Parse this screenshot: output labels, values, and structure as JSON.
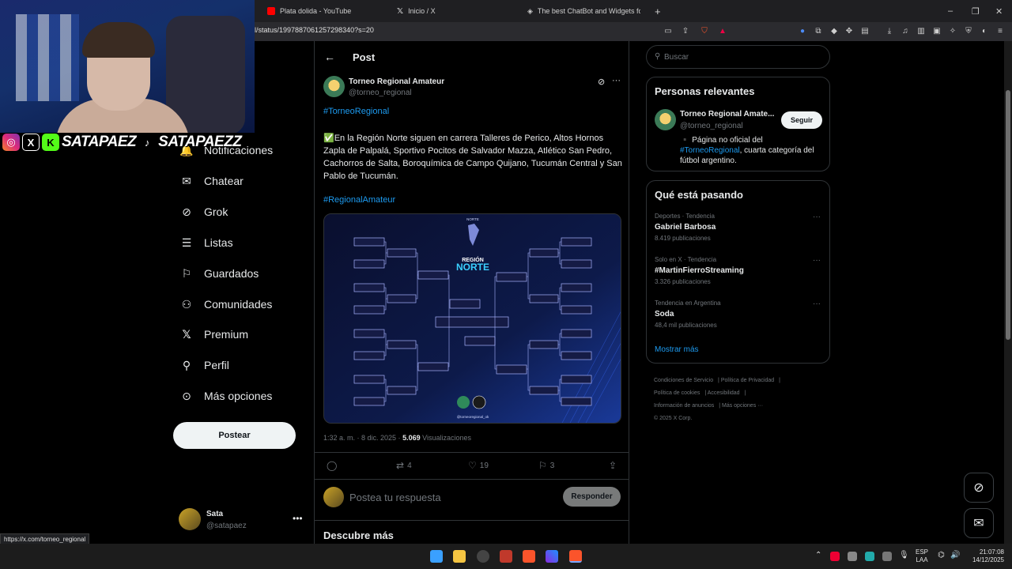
{
  "tabs": [
    {
      "title": "Plata dolida - YouTube",
      "icon": "youtube-icon",
      "color": "#ff0000"
    },
    {
      "title": "Inicio / X",
      "icon": "x-icon",
      "color": "#ffffff"
    },
    {
      "title": "The best ChatBot and Widgets for Ki",
      "icon": "chatbot-icon",
      "color": "#ffffff"
    }
  ],
  "url": "l/status/1997887061257298340?s=20",
  "nav": [
    {
      "label": "Notificaciones",
      "icon": "bell-icon"
    },
    {
      "label": "Chatear",
      "icon": "mail-icon"
    },
    {
      "label": "Grok",
      "icon": "grok-icon"
    },
    {
      "label": "Listas",
      "icon": "list-icon"
    },
    {
      "label": "Guardados",
      "icon": "bookmark-icon"
    },
    {
      "label": "Comunidades",
      "icon": "communities-icon"
    },
    {
      "label": "Premium",
      "icon": "x-icon"
    },
    {
      "label": "Perfil",
      "icon": "person-icon"
    },
    {
      "label": "Más opciones",
      "icon": "more-circle-icon"
    }
  ],
  "post_button": "Postear",
  "me": {
    "name": "Sata",
    "handle": "@satapaez"
  },
  "header": {
    "title": "Post"
  },
  "post": {
    "author": "Torneo Regional Amateur",
    "handle": "@torneo_regional",
    "hashtag1": "#TorneoRegional",
    "body": "✅En la Región Norte siguen en carrera Talleres de Perico, Altos Hornos Zapla de Palpalá, Sportivo Pocitos de Salvador Mazza, Atlético San Pedro, Cachorros de Salta, Boroquímica de Campo Quijano, Tucumán Central y San Pablo de Tucumán.",
    "hashtag2": "#RegionalAmateur",
    "image": {
      "banner": "NORTE",
      "title_small": "REGIÓN",
      "title_big": "NORTE",
      "credit": "@torneoregional_ok"
    },
    "time": "1:32 a. m. · 8 dic. 2025 · ",
    "views_count": "5.069",
    "views_label": "Visualizaciones",
    "replies": "",
    "reposts": "4",
    "likes": "19",
    "bookmarks": "3"
  },
  "reply": {
    "placeholder": "Postea tu respuesta",
    "button": "Responder"
  },
  "discover": "Descubre más",
  "search": {
    "placeholder": "Buscar"
  },
  "relevant": {
    "title": "Personas relevantes",
    "name": "Torneo Regional Amate...",
    "handle": "@torneo_regional",
    "follow": "Seguir",
    "bio_pre": "▪️ Página no oficial del ",
    "bio_tag": "#TorneoRegional",
    "bio_post": ", cuarta categoría del fútbol argentino."
  },
  "trends": {
    "title": "Qué está pasando",
    "items": [
      {
        "category": "Deportes · Tendencia",
        "title": "Gabriel Barbosa",
        "count": "8.419 publicaciones"
      },
      {
        "category": "Solo en X · Tendencia",
        "title": "#MartinFierroStreaming",
        "count": "3.326 publicaciones"
      },
      {
        "category": "Tendencia en Argentina",
        "title": "Soda",
        "count": "48,4 mil publicaciones"
      }
    ],
    "show_more": "Mostrar más"
  },
  "footer": [
    "Condiciones de Servicio",
    "Política de Privacidad",
    "Política de cookies",
    "Accesibilidad",
    "Información de anuncios",
    "Más opciones ···",
    "© 2025 X Corp."
  ],
  "status_link": "https://x.com/torneo_regional",
  "streamer": {
    "name1": "SATAPAEZ",
    "name2": "SATAPAEZZ"
  },
  "taskbar": {
    "lang1": "ESP",
    "lang2": "LAA",
    "time": "21:07:08",
    "date": "14/12/2025"
  },
  "colors": {
    "accent": "#1d9bf0",
    "bg": "#000000",
    "border": "#2f3336",
    "muted": "#71767b"
  }
}
